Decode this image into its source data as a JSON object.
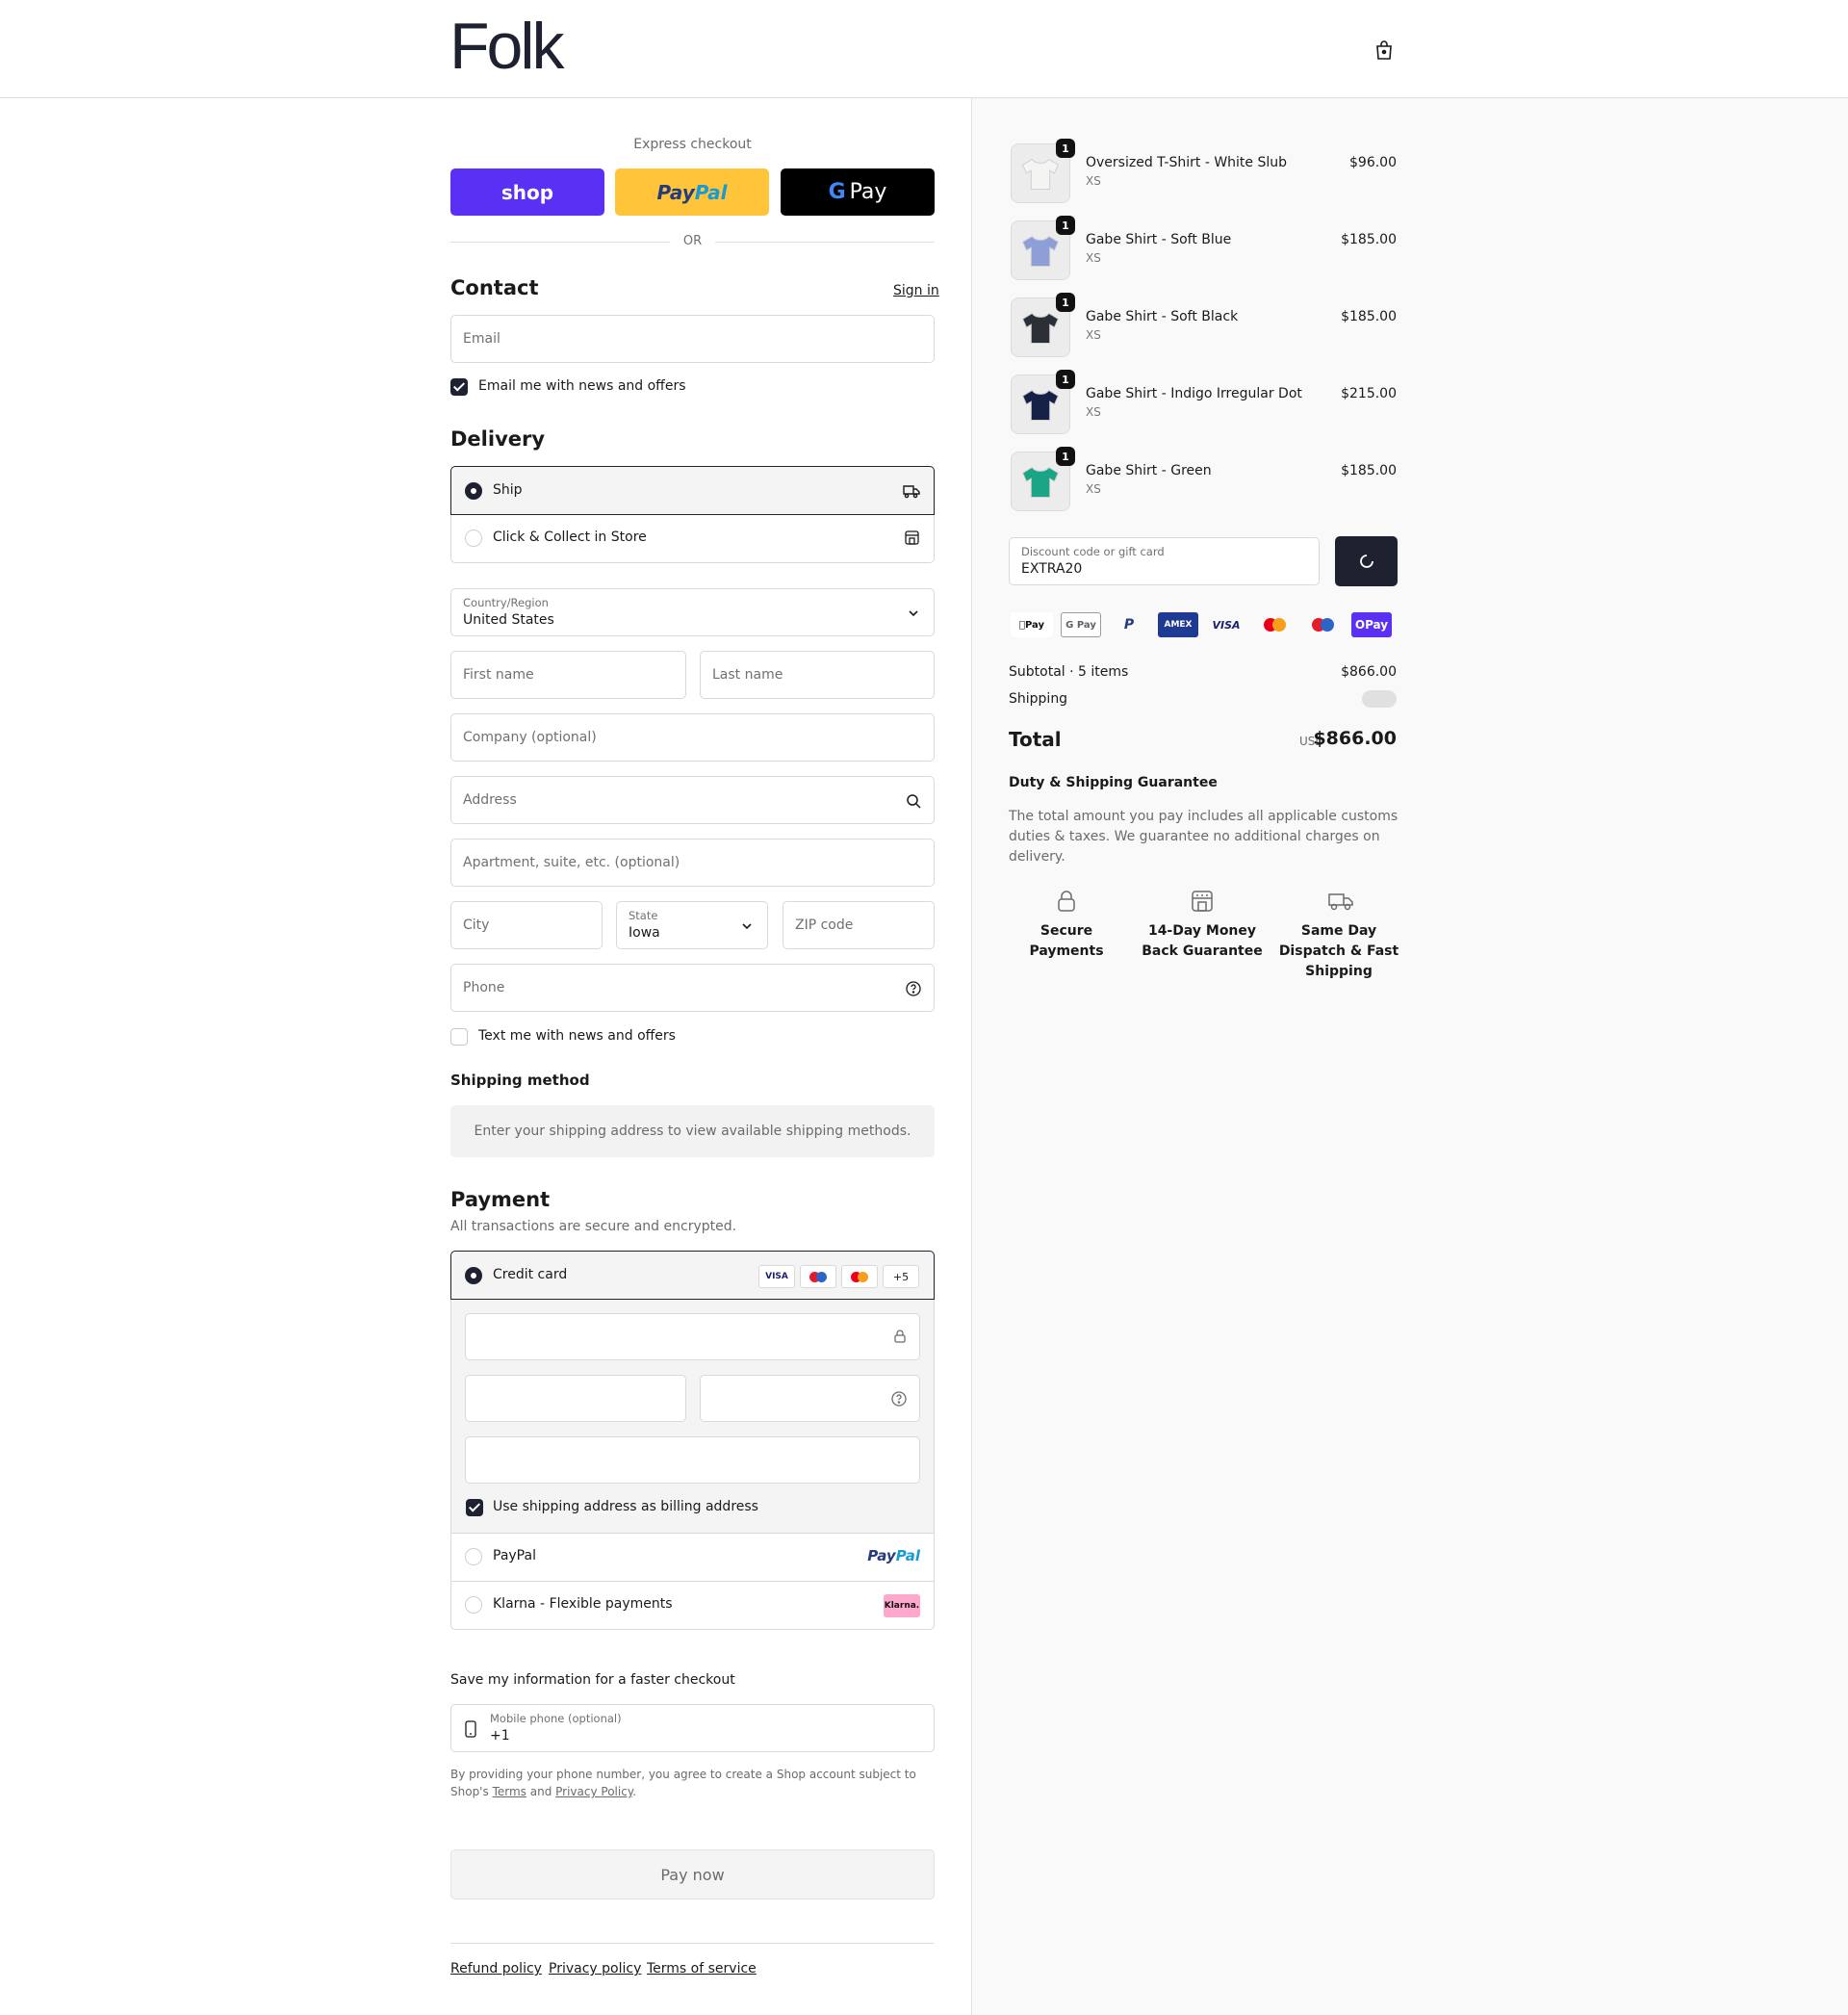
{
  "header": {
    "logo": "Folk"
  },
  "express": {
    "title": "Express checkout",
    "shop_label": "shop",
    "paypal_pay": "Pay",
    "paypal_pal": "Pal",
    "gpay_g": "G",
    "gpay_label": "Pay",
    "or": "OR"
  },
  "contact": {
    "title": "Contact",
    "sign_in": "Sign in",
    "email_placeholder": "Email",
    "news_label": "Email me with news and offers"
  },
  "delivery": {
    "title": "Delivery",
    "options": [
      {
        "label": "Ship",
        "selected": true
      },
      {
        "label": "Click & Collect in Store",
        "selected": false
      }
    ],
    "country_label": "Country/Region",
    "country_value": "United States",
    "first_name": "First name",
    "last_name": "Last name",
    "company": "Company (optional)",
    "address": "Address",
    "apartment": "Apartment, suite, etc. (optional)",
    "city": "City",
    "state_label": "State",
    "state_value": "Iowa",
    "zip": "ZIP code",
    "phone": "Phone",
    "text_news_label": "Text me with news and offers"
  },
  "shipping_method": {
    "title": "Shipping method",
    "note": "Enter your shipping address to view available shipping methods."
  },
  "payment": {
    "title": "Payment",
    "subtitle": "All transactions are secure and encrypted.",
    "credit_card_label": "Credit card",
    "card_logos": [
      "VISA",
      "maestro",
      "mastercard"
    ],
    "more_cards": "+5",
    "billing_label": "Use shipping address as billing address",
    "paypal_label": "PayPal",
    "paypal_logo_pay": "Pay",
    "paypal_logo_pal": "Pal",
    "klarna_label": "Klarna - Flexible payments",
    "klarna_logo": "Klarna."
  },
  "save_info": {
    "title": "Save my information for a faster checkout",
    "phone_label": "Mobile phone (optional)",
    "phone_value": "+1",
    "disclaimer": "By providing your phone number, you agree to create a Shop account subject to Shop's",
    "terms": "Terms",
    "and": "and",
    "privacy": "Privacy Policy",
    "period": "."
  },
  "pay_now": "Pay now",
  "footer_links": [
    "Refund policy",
    "Privacy policy",
    "Terms of service"
  ],
  "summary": {
    "items": [
      {
        "name": "Oversized T-Shirt - White Slub",
        "variant": "XS",
        "price": "$96.00",
        "qty": "1",
        "color": "#f4f4f2"
      },
      {
        "name": "Gabe Shirt - Soft Blue",
        "variant": "XS",
        "price": "$185.00",
        "qty": "1",
        "color": "#8e9fd8"
      },
      {
        "name": "Gabe Shirt - Soft Black",
        "variant": "XS",
        "price": "$185.00",
        "qty": "1",
        "color": "#2b2f36"
      },
      {
        "name": "Gabe Shirt - Indigo Irregular Dot",
        "variant": "XS",
        "price": "$215.00",
        "qty": "1",
        "color": "#162148"
      },
      {
        "name": "Gabe Shirt - Green",
        "variant": "XS",
        "price": "$185.00",
        "qty": "1",
        "color": "#19a586"
      }
    ],
    "discount_label": "Discount code or gift card",
    "discount_value": "EXTRA20",
    "payment_methods": [
      "Pay",
      "G Pay",
      "P",
      "AMEX",
      "VISA",
      "mastercard",
      "Maestro",
      "OPay"
    ],
    "subtotal_label": "Subtotal · 5 items",
    "subtotal_value": "$866.00",
    "shipping_label": "Shipping",
    "total_label": "Total",
    "total_currency": "USD",
    "total_value": "$866.00",
    "guarantee_title": "Duty & Shipping Guarantee",
    "guarantee_text": "The total amount you pay includes all applicable customs duties & taxes. We guarantee no additional charges on delivery.",
    "trust": [
      {
        "label": "Secure Payments",
        "icon": "lock-icon"
      },
      {
        "label": "14-Day Money Back Guarantee",
        "icon": "store-icon"
      },
      {
        "label": "Same Day Dispatch & Fast Shipping",
        "icon": "delivery-truck-icon"
      }
    ]
  },
  "colors": {
    "accent": "#1d2130",
    "shop": "#5a31f4",
    "paypal": "#ffc439",
    "gpay": "#000000",
    "summary_bg": "#f9f9f9"
  }
}
